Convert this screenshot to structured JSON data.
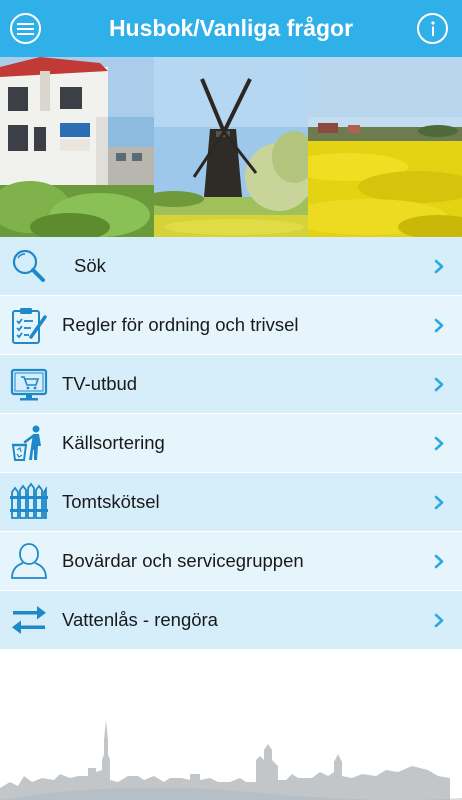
{
  "header": {
    "title": "Husbok/Vanliga frågor",
    "menu_icon": "hamburger-menu-icon",
    "info_icon": "info-icon",
    "background_color": "#2fb0e8"
  },
  "banner": {
    "photos": [
      "house-photo",
      "windmill-photo",
      "rapeseed-field-photo"
    ]
  },
  "menu": {
    "items": [
      {
        "label": "Sök",
        "icon": "search-icon"
      },
      {
        "label": "Regler för ordning och trivsel",
        "icon": "clipboard-checklist-icon"
      },
      {
        "label": "TV-utbud",
        "icon": "tv-monitor-icon"
      },
      {
        "label": "Källsortering",
        "icon": "recycling-person-icon"
      },
      {
        "label": "Tomtskötsel",
        "icon": "fence-icon"
      },
      {
        "label": "Bovärdar och servicegruppen",
        "icon": "person-icon"
      },
      {
        "label": "Vattenlås - rengöra",
        "icon": "swap-arrows-icon"
      }
    ],
    "chevron_icon": "chevron-right-icon",
    "accent_color": "#1e88c8"
  },
  "footer": {
    "graphic": "town-skyline-silhouette"
  }
}
